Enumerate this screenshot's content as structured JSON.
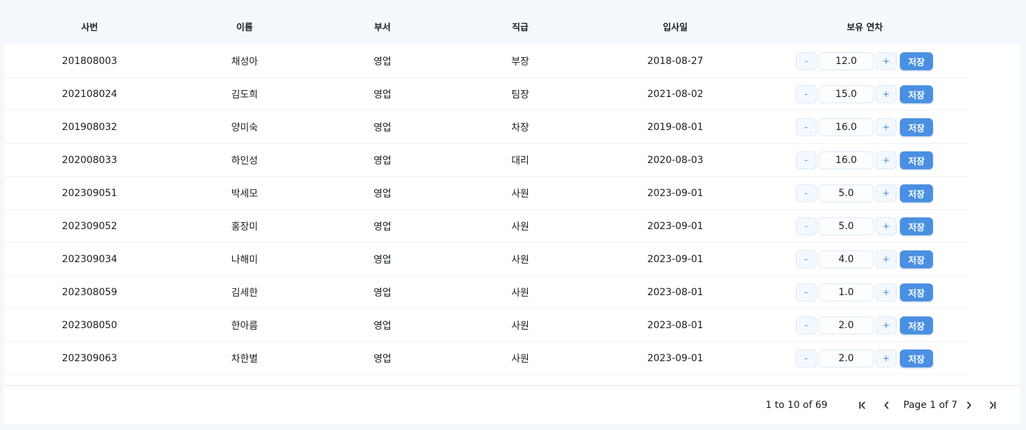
{
  "columns": [
    "사번",
    "이름",
    "부서",
    "직급",
    "입사일",
    "보유 연차"
  ],
  "rows": [
    {
      "id": "201808003",
      "name": "채성아",
      "dept": "영업",
      "title": "부장",
      "hired": "2018-08-27",
      "leave": "12.0"
    },
    {
      "id": "202108024",
      "name": "김도희",
      "dept": "영업",
      "title": "팀장",
      "hired": "2021-08-02",
      "leave": "15.0"
    },
    {
      "id": "201908032",
      "name": "양미숙",
      "dept": "영업",
      "title": "차장",
      "hired": "2019-08-01",
      "leave": "16.0"
    },
    {
      "id": "202008033",
      "name": "하인성",
      "dept": "영업",
      "title": "대리",
      "hired": "2020-08-03",
      "leave": "16.0"
    },
    {
      "id": "202309051",
      "name": "박세모",
      "dept": "영업",
      "title": "사원",
      "hired": "2023-09-01",
      "leave": "5.0"
    },
    {
      "id": "202309052",
      "name": "홍장미",
      "dept": "영업",
      "title": "사원",
      "hired": "2023-09-01",
      "leave": "5.0"
    },
    {
      "id": "202309034",
      "name": "나해미",
      "dept": "영업",
      "title": "사원",
      "hired": "2023-09-01",
      "leave": "4.0"
    },
    {
      "id": "202308059",
      "name": "김세한",
      "dept": "영업",
      "title": "사원",
      "hired": "2023-08-01",
      "leave": "1.0"
    },
    {
      "id": "202308050",
      "name": "한아름",
      "dept": "영업",
      "title": "사원",
      "hired": "2023-08-01",
      "leave": "2.0"
    },
    {
      "id": "202309063",
      "name": "차한별",
      "dept": "영업",
      "title": "사원",
      "hired": "2023-09-01",
      "leave": "2.0"
    }
  ],
  "controls": {
    "minus": "-",
    "plus": "+",
    "save": "저장"
  },
  "pagination": {
    "summary": "1 to 10 of 69",
    "page_label": "Page 1 of 7",
    "icons": [
      "first-page-icon",
      "previous-page-icon",
      "next-page-icon",
      "last-page-icon"
    ]
  },
  "colors": {
    "accent": "#4a90e2",
    "header_bg": "#f5f9fd",
    "page_bg": "#f3f6fa"
  }
}
